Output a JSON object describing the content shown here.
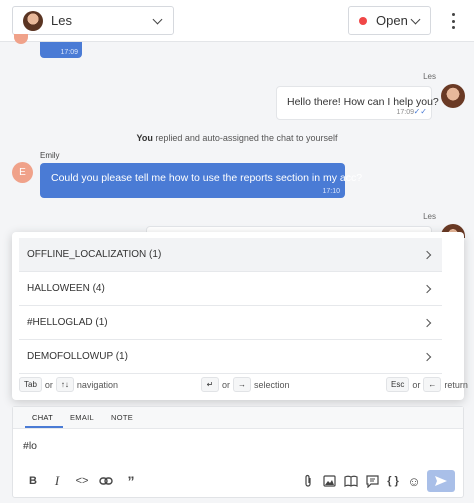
{
  "header": {
    "assignee_name": "Les",
    "status_label": "Open",
    "colors": {
      "status_dot": "#f04747"
    }
  },
  "conversation": {
    "top_partial_time": "17:09",
    "messages": [
      {
        "sender": "Les",
        "text": "Hello there! How can I help you?",
        "time": "17:09",
        "direction": "outgoing"
      },
      {
        "sender": "Emily",
        "avatar_initial": "E",
        "text": "Could you please tell me how to use the reports section in my acc?",
        "time": "17:10",
        "direction": "incoming"
      }
    ],
    "system_actor": "You",
    "system_text": "replied and auto-assigned the chat to yourself",
    "last_sender": "Les"
  },
  "suggestions": {
    "items": [
      {
        "label": "OFFLINE_LOCALIZATION (1)"
      },
      {
        "label": "HALLOWEEN (4)"
      },
      {
        "label": "#HELLOGLAD (1)"
      },
      {
        "label": "DEMOFOLLOWUP (1)"
      }
    ],
    "hints": {
      "tab_key": "Tab",
      "or1": "or",
      "arrows_key": "↑↓",
      "navigation": "navigation",
      "enter_key": "↵",
      "or2": "or",
      "right_key": "→",
      "selection": "selection",
      "esc_key": "Esc",
      "or3": "or",
      "left_key": "←",
      "return": "return"
    }
  },
  "composer": {
    "tabs": [
      "CHAT",
      "EMAIL",
      "NOTE"
    ],
    "active_tab": "CHAT",
    "draft_text": "#lo",
    "accent": "#4a7bd5",
    "toolbar_icons": [
      "bold-icon",
      "italic-icon",
      "code-icon",
      "link-icon",
      "quote-icon",
      "attachment-icon",
      "image-icon",
      "knowledge-base-icon",
      "canned-response-icon",
      "variable-icon",
      "emoji-icon",
      "send-icon"
    ]
  }
}
